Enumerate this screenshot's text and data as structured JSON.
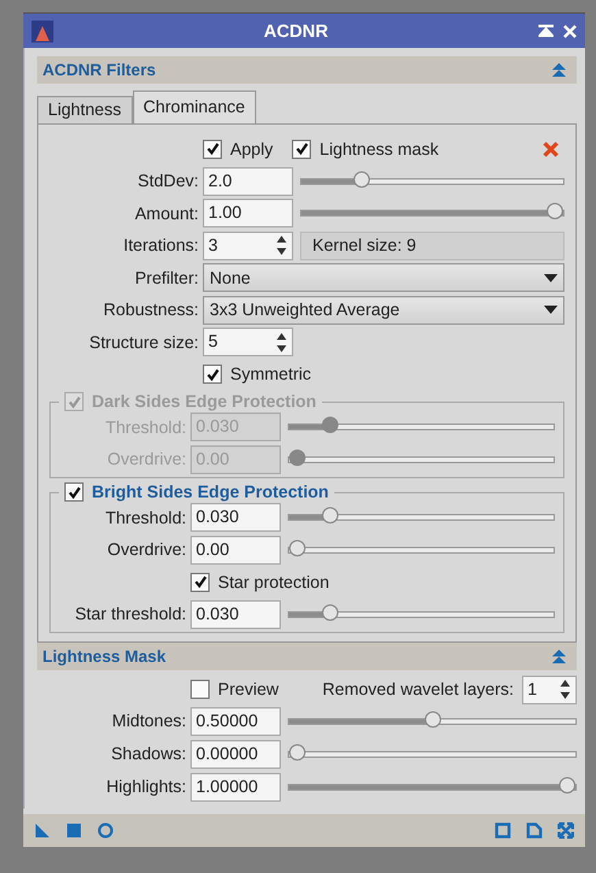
{
  "window": {
    "title": "ACDNR"
  },
  "filters": {
    "title": "ACDNR Filters",
    "tabs": [
      {
        "label": "Lightness",
        "selected": false
      },
      {
        "label": "Chrominance",
        "selected": true
      }
    ],
    "rows": [
      {
        "kind": "checks",
        "items": [
          {
            "label": "Apply",
            "checked": true
          },
          {
            "label": "Lightness mask",
            "checked": true
          }
        ]
      },
      {
        "kind": "slider",
        "label": "StdDev:",
        "value": "2.0",
        "level": 0.21
      },
      {
        "kind": "slider",
        "label": "Amount:",
        "value": "1.00",
        "level": 1
      },
      {
        "kind": "spin",
        "label": "Iterations:",
        "value": "3",
        "info": "Kernel size: 9"
      },
      {
        "kind": "combo",
        "label": "Prefilter:",
        "value": "None"
      },
      {
        "kind": "combo",
        "label": "Robustness:",
        "value": "3x3 Unweighted Average"
      },
      {
        "kind": "spin",
        "label": "Structure size:",
        "value": "5"
      },
      {
        "kind": "check",
        "label": "Symmetric",
        "checked": true
      },
      {
        "kind": "group",
        "title": "Dark Sides Edge Protection",
        "checked": true,
        "disabled": true,
        "rows": [
          {
            "kind": "slider",
            "label": "Threshold:",
            "value": "0.030",
            "level": 0.13
          },
          {
            "kind": "slider",
            "label": "Overdrive:",
            "value": "0.00",
            "level": 0
          }
        ]
      },
      {
        "kind": "group",
        "title": "Bright Sides Edge Protection",
        "checked": true,
        "disabled": false,
        "rows": [
          {
            "kind": "slider",
            "label": "Threshold:",
            "value": "0.030",
            "level": 0.13
          },
          {
            "kind": "slider",
            "label": "Overdrive:",
            "value": "0.00",
            "level": 0
          },
          {
            "kind": "check",
            "label": "Star protection",
            "checked": true
          },
          {
            "kind": "slider",
            "label": "Star threshold:",
            "value": "0.030",
            "level": 0.13
          }
        ]
      }
    ]
  },
  "mask": {
    "title": "Lightness Mask",
    "rows": [
      {
        "kind": "check_spin",
        "label": "Preview",
        "checked": false,
        "spin_label": "Removed wavelet layers:",
        "value": "1"
      },
      {
        "kind": "slider",
        "label": "Midtones:",
        "value": "0.50000",
        "level": 0.5
      },
      {
        "kind": "slider",
        "label": "Shadows:",
        "value": "0.00000",
        "level": 0
      },
      {
        "kind": "slider",
        "label": "Highlights:",
        "value": "1.00000",
        "level": 1
      }
    ]
  }
}
